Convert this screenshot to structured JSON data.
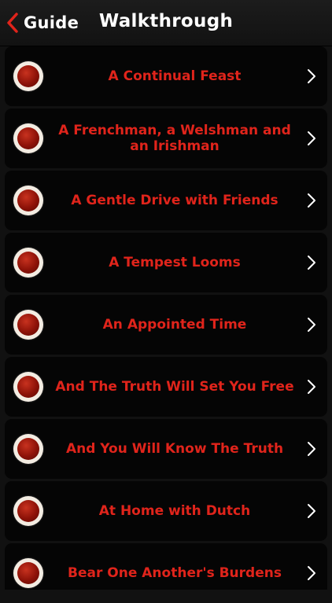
{
  "navbar": {
    "back_label": "Guide",
    "title": "Walkthrough"
  },
  "colors": {
    "accent": "#e0241b",
    "background": "#111111",
    "row_background": "#050505"
  },
  "list": {
    "items": [
      {
        "label": "A Continual Feast"
      },
      {
        "label": "A Frenchman, a Welshman and an Irishman"
      },
      {
        "label": "A Gentle Drive with Friends"
      },
      {
        "label": "A Tempest Looms"
      },
      {
        "label": "An Appointed Time"
      },
      {
        "label": "And The Truth Will Set You Free"
      },
      {
        "label": "And You Will Know The Truth"
      },
      {
        "label": "At Home with Dutch"
      },
      {
        "label": "Bear One Another's Burdens"
      }
    ]
  }
}
